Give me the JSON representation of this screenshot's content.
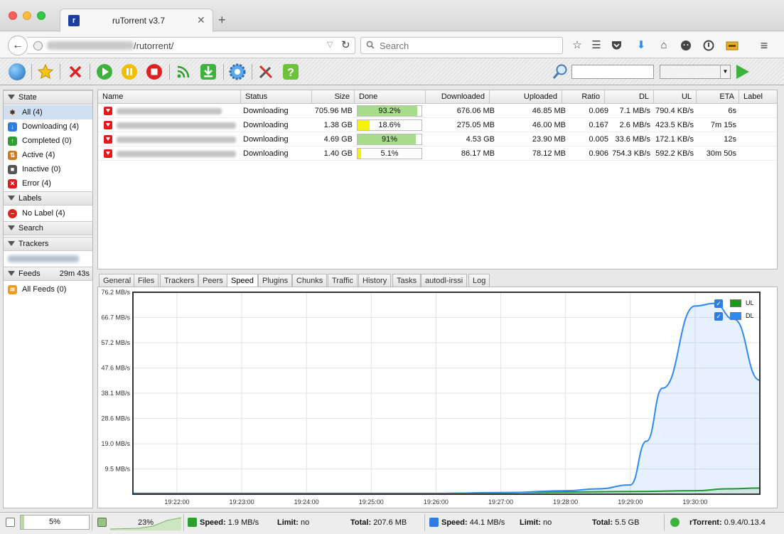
{
  "browser": {
    "tab_title": "ruTorrent v3.7",
    "url_path": "/rutorrent/",
    "search_placeholder": "Search"
  },
  "toolbar": {
    "icons": [
      "globe-icon",
      "star-icon",
      "remove-icon",
      "start-icon",
      "pause-icon",
      "stop-icon",
      "rss-icon",
      "download-icon",
      "settings-icon",
      "tools-icon",
      "help-icon"
    ]
  },
  "sidebar": {
    "state_header": "State",
    "state_items": [
      {
        "label": "All (4)",
        "icon": "all-icon",
        "color": "#444444"
      },
      {
        "label": "Downloading (4)",
        "icon": "downloading-icon",
        "color": "#2f7de1"
      },
      {
        "label": "Completed (0)",
        "icon": "completed-icon",
        "color": "#2f9e2f"
      },
      {
        "label": "Active (4)",
        "icon": "active-icon",
        "color": "#d07a1a"
      },
      {
        "label": "Inactive (0)",
        "icon": "inactive-icon",
        "color": "#555555"
      },
      {
        "label": "Error (4)",
        "icon": "error-icon",
        "color": "#e01b1b"
      }
    ],
    "labels_header": "Labels",
    "no_label": "No Label (4)",
    "search_header": "Search",
    "trackers_header": "Trackers",
    "feeds_header": "Feeds",
    "feeds_timer": "29m 43s",
    "all_feeds": "All Feeds (0)"
  },
  "table": {
    "columns": [
      "Name",
      "Status",
      "Size",
      "Done",
      "Downloaded",
      "Uploaded",
      "Ratio",
      "DL",
      "UL",
      "ETA",
      "Label"
    ],
    "rows": [
      {
        "status": "Downloading",
        "size": "705.96 MB",
        "done": "93.2%",
        "done_frac": 0.932,
        "downloaded": "676.06 MB",
        "uploaded": "46.85 MB",
        "ratio": "0.069",
        "dl": "7.1 MB/s",
        "ul": "790.4 KB/s",
        "eta": "6s",
        "label": ""
      },
      {
        "status": "Downloading",
        "size": "1.38 GB",
        "done": "18.6%",
        "done_frac": 0.186,
        "downloaded": "275.05 MB",
        "uploaded": "46.00 MB",
        "ratio": "0.167",
        "dl": "2.6 MB/s",
        "ul": "423.5 KB/s",
        "eta": "7m 15s",
        "label": ""
      },
      {
        "status": "Downloading",
        "size": "4.69 GB",
        "done": "91%",
        "done_frac": 0.91,
        "downloaded": "4.53 GB",
        "uploaded": "23.90 MB",
        "ratio": "0.005",
        "dl": "33.6 MB/s",
        "ul": "172.1 KB/s",
        "eta": "12s",
        "label": ""
      },
      {
        "status": "Downloading",
        "size": "1.40 GB",
        "done": "5.1%",
        "done_frac": 0.051,
        "downloaded": "86.17 MB",
        "uploaded": "78.12 MB",
        "ratio": "0.906",
        "dl": "754.3 KB/s",
        "ul": "592.2 KB/s",
        "eta": "30m 50s",
        "label": ""
      }
    ]
  },
  "detail_tabs": [
    "General",
    "Files",
    "Trackers",
    "Peers",
    "Speed",
    "Plugins",
    "Chunks",
    "Traffic",
    "History",
    "Tasks",
    "autodl-irssi",
    "Log"
  ],
  "active_tab": "Speed",
  "chart_data": {
    "type": "line",
    "y_ticks": [
      "9.5 MB/s",
      "19.0 MB/s",
      "28.6 MB/s",
      "38.1 MB/s",
      "47.6 MB/s",
      "57.2 MB/s",
      "66.7 MB/s",
      "76.2 MB/s"
    ],
    "x_ticks": [
      "19:22:00",
      "19:23:00",
      "19:24:00",
      "19:25:00",
      "19:26:00",
      "19:27:00",
      "19:28:00",
      "19:29:00",
      "19:30:00"
    ],
    "ylim": [
      0,
      76.2
    ],
    "xlim_minutes": [
      -0.68,
      9.0
    ],
    "legend": "top-right",
    "colors": {
      "UL": "#1a9a1a",
      "DL": "#2f8af0"
    },
    "series": [
      {
        "name": "UL",
        "x": [
          -0.68,
          0,
          1,
          2,
          3,
          4,
          5,
          6,
          7,
          8,
          8.5,
          9.0
        ],
        "y": [
          0.3,
          0.3,
          0.3,
          0.3,
          0.3,
          0.3,
          0.6,
          0.8,
          1.0,
          1.3,
          2.0,
          2.3
        ]
      },
      {
        "name": "DL",
        "x": [
          -0.68,
          0,
          1,
          2,
          3,
          4,
          5,
          6,
          6.5,
          7,
          7.25,
          7.5,
          8.0,
          8.3,
          8.6,
          9.0
        ],
        "y": [
          0.3,
          0.3,
          0.3,
          0.3,
          0.3,
          0.3,
          0.5,
          1.3,
          2.0,
          3.5,
          20,
          40,
          71,
          72,
          66,
          43
        ]
      }
    ]
  },
  "statusbar": {
    "disk_pct": "5%",
    "cpu_pct": "23%",
    "dl_speed_label": "Speed:",
    "dl_speed": "1.9 MB/s",
    "dl_limit_label": "Limit:",
    "dl_limit": "no",
    "dl_total_label": "Total:",
    "dl_total": "207.6 MB",
    "ul_speed_label": "Speed:",
    "ul_speed": "44.1 MB/s",
    "ul_limit_label": "Limit:",
    "ul_limit": "no",
    "ul_total_label": "Total:",
    "ul_total": "5.5 GB",
    "client_label": "rTorrent:",
    "client_version": "0.9.4/0.13.4"
  }
}
